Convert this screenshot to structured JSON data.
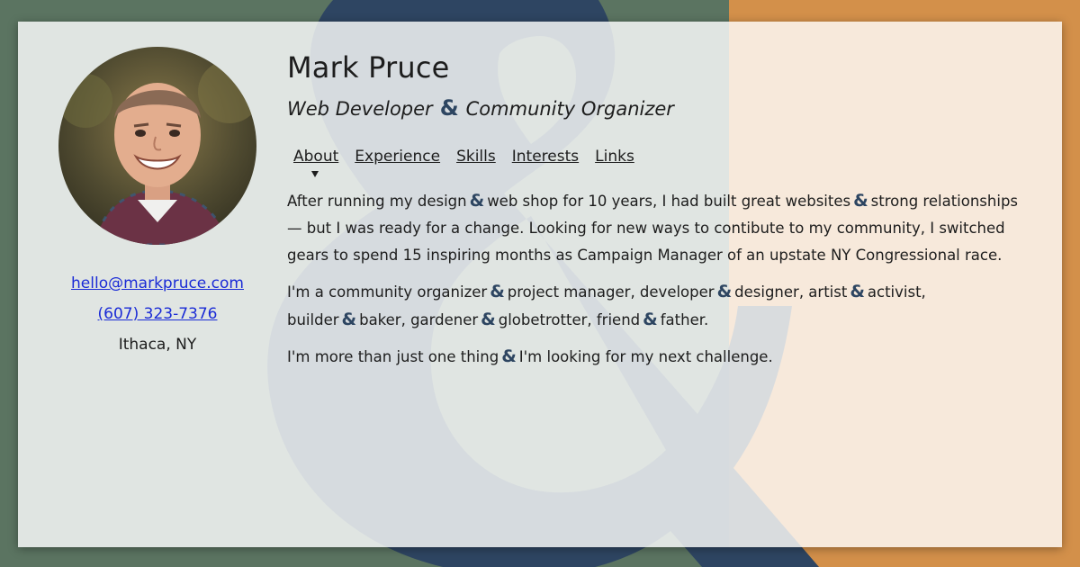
{
  "profile": {
    "name": "Mark Pruce",
    "title_part1": "Web Developer",
    "title_amp": "&",
    "title_part2": "Community Organizer",
    "email": "hello@markpruce.com",
    "phone": "(607) 323-7376",
    "location": "Ithaca, NY"
  },
  "nav": {
    "items": [
      "About",
      "Experience",
      "Skills",
      "Interests",
      "Links"
    ],
    "active": "About"
  },
  "about": {
    "p1": [
      "After running my design",
      "web shop for 10 years, I had built great websites",
      "strong relationships — but I was ready for a change. Looking for new ways to contibute to my community, I switched gears to spend 15 inspiring months as Campaign Manager of an upstate NY Congressional race."
    ],
    "p2": [
      "I'm a community organizer",
      "project manager, developer",
      "designer, artist",
      "activist, builder",
      "baker, gardener",
      "globetrotter, friend",
      "father."
    ],
    "p3": [
      "I'm more than just one thing",
      "I'm looking for my next challenge."
    ],
    "amp": "&"
  },
  "colors": {
    "page_green": "#5b7461",
    "page_orange": "#d3904a",
    "ampersand_navy": "#2d4561",
    "card_left": "#e0e5e2",
    "card_right": "#f7e9db",
    "link_blue": "#1a2bd6"
  }
}
